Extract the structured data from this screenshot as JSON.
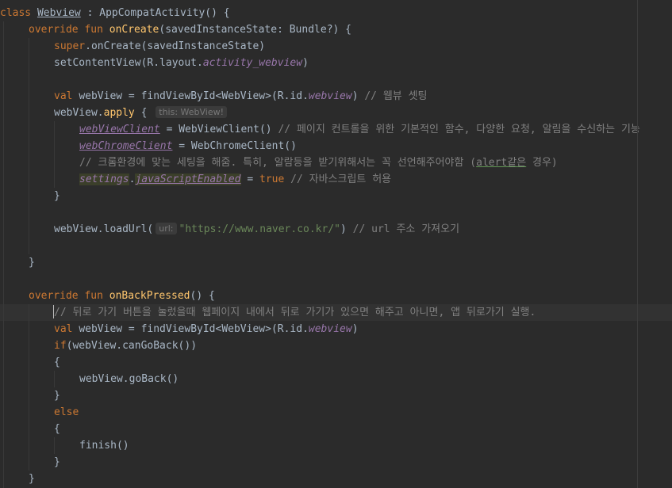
{
  "editor": {
    "language": "kotlin",
    "lines": [
      {
        "tokens": [
          [
            "kw",
            "class "
          ],
          [
            "cls-u",
            "Webview"
          ],
          [
            "plain",
            " : AppCompatActivity() {"
          ]
        ]
      },
      {
        "tokens": [
          [
            "kw",
            "override fun "
          ],
          [
            "fn",
            "onCreate"
          ],
          [
            "plain",
            "(savedInstanceState: Bundle?) {"
          ]
        ]
      },
      {
        "tokens": [
          [
            "kw",
            "super"
          ],
          [
            "plain",
            ".onCreate(savedInstanceState)"
          ]
        ]
      },
      {
        "tokens": [
          [
            "plain",
            "setContentView(R.layout."
          ],
          [
            "fld",
            "activity_webview"
          ],
          [
            "plain",
            ")"
          ]
        ]
      },
      {
        "tokens": []
      },
      {
        "tokens": [
          [
            "kw",
            "val "
          ],
          [
            "plain",
            "webView = findViewById<WebView>(R.id."
          ],
          [
            "fld",
            "webview"
          ],
          [
            "plain",
            ") "
          ],
          [
            "cmt",
            "// 웹뷰 셋팅"
          ]
        ]
      },
      {
        "tokens": [
          [
            "plain",
            "webView."
          ],
          [
            "fn",
            "apply"
          ],
          [
            "plain",
            " { "
          ],
          [
            "hint",
            "this: WebView!"
          ]
        ]
      },
      {
        "tokens": [
          [
            "fld-u",
            "webViewClient"
          ],
          [
            "plain",
            " = WebViewClient() "
          ],
          [
            "cmt",
            "// 페이지 컨트롤을 위한 기본적인 함수, 다양한 요청, 알림을 수신하는 기능"
          ]
        ]
      },
      {
        "tokens": [
          [
            "fld-u",
            "webChromeClient"
          ],
          [
            "plain",
            " = WebChromeClient()"
          ]
        ]
      },
      {
        "tokens": [
          [
            "cmt",
            "// 크롬환경에 맞는 세팅을 해줌. 특히, 알람등을 받기위해서는 꼭 선언해주어야함 ("
          ],
          [
            "cmt-u",
            "alert같은"
          ],
          [
            "cmt",
            " 경우)"
          ]
        ]
      },
      {
        "tokens": [
          [
            "hl-set",
            "settings"
          ],
          [
            "plain",
            "."
          ],
          [
            "hl-set-u",
            "javaScriptEnabled"
          ],
          [
            "plain",
            " = "
          ],
          [
            "kw",
            "true "
          ],
          [
            "cmt",
            "// 자바스크립트 허용"
          ]
        ]
      },
      {
        "tokens": [
          [
            "plain",
            "}"
          ]
        ]
      },
      {
        "tokens": []
      },
      {
        "tokens": [
          [
            "plain",
            "webView.loadUrl("
          ],
          [
            "hint",
            "url:"
          ],
          [
            "str",
            "\"https://www.naver.co.kr/\""
          ],
          [
            "plain",
            ") "
          ],
          [
            "cmt",
            "// url 주소 가져오기"
          ]
        ]
      },
      {
        "tokens": []
      },
      {
        "tokens": [
          [
            "plain",
            "}"
          ]
        ]
      },
      {
        "tokens": []
      },
      {
        "tokens": [
          [
            "kw",
            "override fun "
          ],
          [
            "fn",
            "onBackPressed"
          ],
          [
            "plain",
            "() {"
          ]
        ]
      },
      {
        "tokens": [
          [
            "cmt",
            "// 뒤로 가기 버튼을 눌렀을때 웹페이지 내에서 뒤로 가기가 있으면 해주고 아니면, 앱 뒤로가기 실행."
          ]
        ]
      },
      {
        "tokens": [
          [
            "kw",
            "val "
          ],
          [
            "plain",
            "webView = findViewById<WebView>(R.id."
          ],
          [
            "fld",
            "webview"
          ],
          [
            "plain",
            ")"
          ]
        ]
      },
      {
        "tokens": [
          [
            "kw",
            "if"
          ],
          [
            "plain",
            "(webView.canGoBack())"
          ]
        ]
      },
      {
        "tokens": [
          [
            "plain",
            "{"
          ]
        ]
      },
      {
        "tokens": [
          [
            "plain",
            "webView.goBack()"
          ]
        ]
      },
      {
        "tokens": [
          [
            "plain",
            "}"
          ]
        ]
      },
      {
        "tokens": [
          [
            "kw",
            "else"
          ]
        ]
      },
      {
        "tokens": [
          [
            "plain",
            "{"
          ]
        ]
      },
      {
        "tokens": [
          [
            "plain",
            "finish()"
          ]
        ]
      },
      {
        "tokens": [
          [
            "plain",
            "}"
          ]
        ]
      },
      {
        "tokens": [
          [
            "plain",
            "}"
          ]
        ]
      }
    ]
  }
}
